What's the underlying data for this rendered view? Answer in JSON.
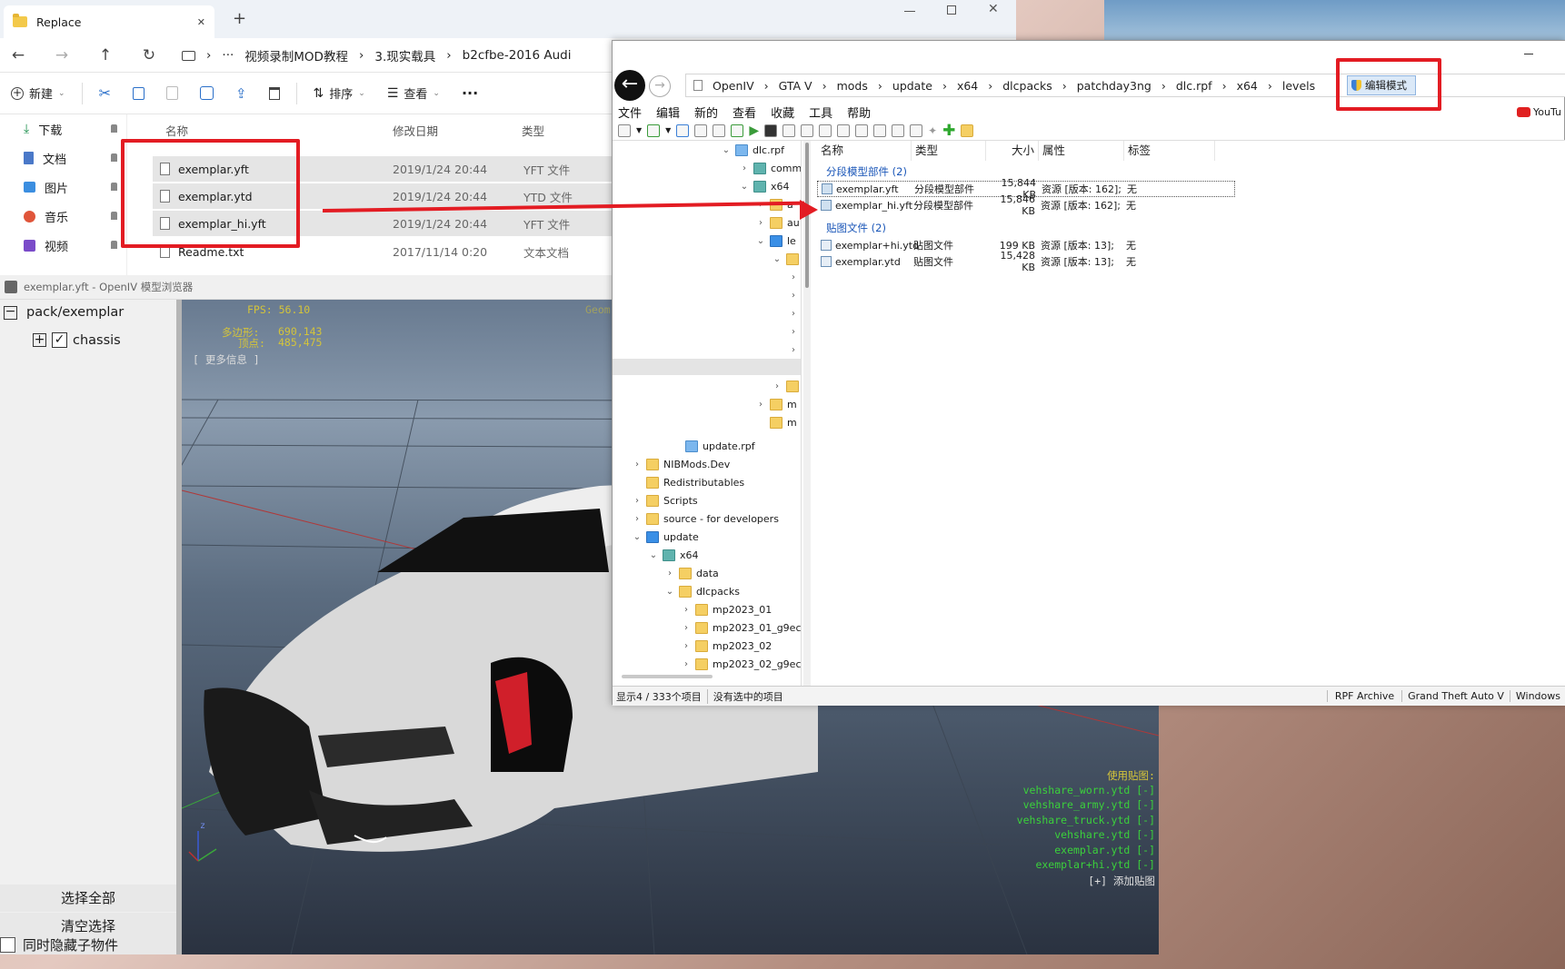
{
  "explorer": {
    "tab_title": "Replace",
    "tab_close": "✕",
    "tab_add": "+",
    "breadcrumb": [
      "视频录制MOD教程",
      "3.现实载具",
      "b2cfbe-2016 Audi"
    ],
    "breadcrumb_more": "···",
    "toolbar": {
      "new_label": "新建",
      "sort_label": "排序",
      "view_label": "查看",
      "more_label": "···"
    },
    "nav": [
      {
        "label": "下载"
      },
      {
        "label": "文档"
      },
      {
        "label": "图片"
      },
      {
        "label": "音乐"
      },
      {
        "label": "视频"
      }
    ],
    "columns": {
      "name": "名称",
      "date": "修改日期",
      "type": "类型"
    },
    "files": [
      {
        "name": "exemplar.yft",
        "date": "2019/1/24 20:44",
        "type": "YFT 文件"
      },
      {
        "name": "exemplar.ytd",
        "date": "2019/1/24 20:44",
        "type": "YTD 文件"
      },
      {
        "name": "exemplar_hi.yft",
        "date": "2019/1/24 20:44",
        "type": "YFT 文件"
      },
      {
        "name": "Readme.txt",
        "date": "2017/11/14 0:20",
        "type": "文本文档"
      }
    ]
  },
  "viewer": {
    "title": "exemplar.yft - OpenIV 模型浏览器",
    "tree_root": "pack/exemplar",
    "tree_child": "chassis",
    "select_all": "选择全部",
    "clear_selection": "清空选择",
    "hide_children": "同时隐藏子物件",
    "fps": "FPS: 56.10",
    "geom": "Geom",
    "polygons_label": "多边形:",
    "polygons_value": "690,143",
    "vertices_label": "顶点:",
    "vertices_value": "485,475",
    "more_info": "[ 更多信息 ]",
    "textures_title": "使用贴图:",
    "textures": [
      "vehshare_worn.ytd [-]",
      "vehshare_army.ytd [-]",
      "vehshare_truck.ytd [-]",
      "vehshare.ytd [-]",
      "exemplar.ytd [-]",
      "exemplar+hi.ytd [-]"
    ],
    "add_texture": "[+] 添加贴图",
    "axis_z": "z"
  },
  "openiv": {
    "address": [
      "OpenIV",
      "GTA V",
      "mods",
      "update",
      "x64",
      "dlcpacks",
      "patchday3ng",
      "dlc.rpf",
      "x64",
      "levels"
    ],
    "edit_mode": "编辑模式",
    "menu": [
      "文件",
      "编辑",
      "新的",
      "查看",
      "收藏",
      "工具",
      "帮助"
    ],
    "youtube": "YouTu",
    "tree": [
      {
        "label": "dlc.rpf"
      },
      {
        "label": "comm"
      },
      {
        "label": "x64"
      },
      {
        "label": "a"
      },
      {
        "label": "au"
      },
      {
        "label": "le"
      },
      {
        "label": "m"
      },
      {
        "label": "m"
      },
      {
        "label": "update.rpf"
      },
      {
        "label": "NIBMods.Dev"
      },
      {
        "label": "Redistributables"
      },
      {
        "label": "Scripts"
      },
      {
        "label": "source - for developers"
      },
      {
        "label": "update"
      },
      {
        "label": "x64"
      },
      {
        "label": "data"
      },
      {
        "label": "dlcpacks"
      },
      {
        "label": "mp2023_01"
      },
      {
        "label": "mp2023_01_g9ec"
      },
      {
        "label": "mp2023_02"
      },
      {
        "label": "mp2023_02_g9ec"
      }
    ],
    "columns": {
      "name": "名称",
      "type": "类型",
      "size": "大小",
      "attr": "属性",
      "tag": "标签"
    },
    "group1": "分段模型部件 (2)",
    "group2": "贴图文件 (2)",
    "files": [
      {
        "name": "exemplar.yft",
        "type": "分段模型部件",
        "size": "15,844 KB",
        "attr": "资源 [版本: 162];",
        "tag": "无"
      },
      {
        "name": "exemplar_hi.yft",
        "type": "分段模型部件",
        "size": "15,846 KB",
        "attr": "资源 [版本: 162];",
        "tag": "无"
      },
      {
        "name": "exemplar+hi.ytd",
        "type": "贴图文件",
        "size": "199 KB",
        "attr": "资源 [版本: 13];",
        "tag": "无"
      },
      {
        "name": "exemplar.ytd",
        "type": "贴图文件",
        "size": "15,428 KB",
        "attr": "资源 [版本: 13];",
        "tag": "无"
      }
    ],
    "status_left": "显示4 / 333个项目",
    "status_mid": "没有选中的项目",
    "status_right": [
      "RPF Archive",
      "Grand Theft Auto V",
      "Windows"
    ]
  },
  "colors": {
    "annotation_red": "#e31c23",
    "hud_yellow": "#d4c43a",
    "hud_green": "#3bd13b",
    "link_blue": "#1a56b8"
  }
}
